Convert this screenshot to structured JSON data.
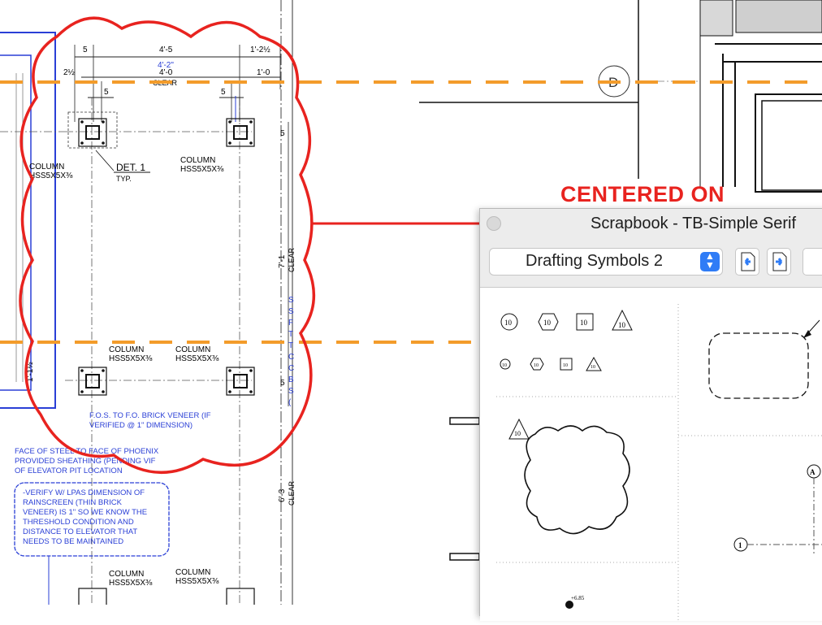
{
  "drawing": {
    "dims_top": [
      "5",
      "4'-5",
      "1'-2½",
      "2½",
      "4'-2\"",
      "4'-0",
      "CLEAR",
      "1'-0",
      "5",
      "5"
    ],
    "right_dims": [
      "5",
      "7'-1",
      "CLEAR",
      "5",
      "6'-3",
      "CLEAR"
    ],
    "left_dim": "1'-1½",
    "detail_label": "DET. 1",
    "detail_sub": "TYP.",
    "column_word": "COLUMN",
    "column_size": "HSS5X5X⅜",
    "grid_bubble": "D",
    "vertical_blue_text": [
      "S",
      "S",
      "F",
      "T",
      "T",
      "C",
      "C",
      "B",
      "S",
      "("
    ],
    "blue_note_1": [
      "F.O.S. TO F.O. BRICK VENEER (IF",
      "VERIFIED @ 1\" DIMENSION)"
    ],
    "blue_note_2": [
      "FACE OF STEEL TO FACE OF PHOENIX",
      "PROVIDED SHEATHING (PENDING VIF",
      "OF ELEVATOR PIT LOCATION"
    ],
    "cloud_note": [
      "-VERIFY W/ LPAS DIMENSION OF",
      "RAINSCREEN (THIN BRICK",
      "VENEER) IS 1\" SO WE KNOW THE",
      "THRESHOLD CONDITION AND",
      "DISTANCE TO ELEVATOR THAT",
      "NEEDS TO BE MAINTAINED"
    ]
  },
  "annotation": {
    "centered_label": "CENTERED ON",
    "cloud_color": "#e8231f",
    "dash_color": "#f39c2b"
  },
  "scrapbook": {
    "title": "Scrapbook - TB-Simple Serif",
    "category": "Drafting Symbols 2",
    "symbol_tag": "10",
    "grid_tags": [
      "A",
      "1"
    ],
    "elevation_tag": "+6.85",
    "icons": [
      "close-icon",
      "select-arrows-icon",
      "page-prev-icon",
      "page-next-icon"
    ]
  }
}
